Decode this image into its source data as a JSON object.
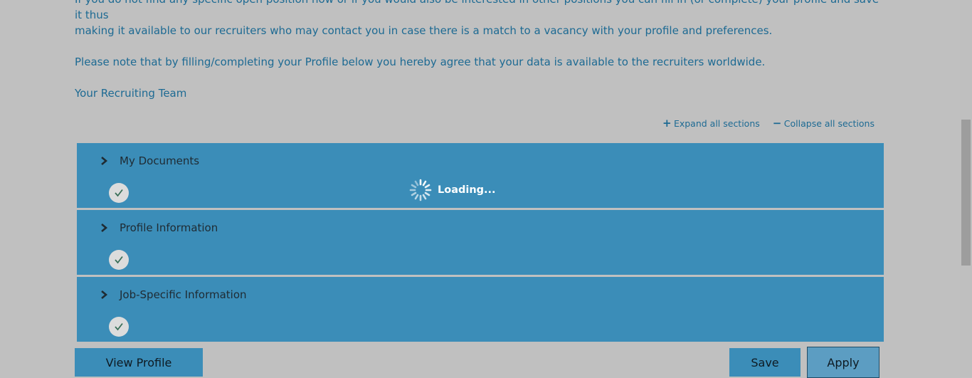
{
  "intro": {
    "line1": "If you do not find any specific open position now or if you would also be interested in other positions you can fill in (or complete) your profile and save it thus",
    "line2": "making it available to our recruiters who may contact you in case there is a match to a vacancy with your profile and preferences.",
    "line3": "Please note that by filling/completing your Profile below you hereby agree that your data is available to the recruiters worldwide.",
    "signature": "Your Recruiting Team"
  },
  "controls": {
    "expand_label": "Expand all sections",
    "collapse_label": "Collapse all sections"
  },
  "sections": [
    {
      "title": "My Documents"
    },
    {
      "title": "Profile Information"
    },
    {
      "title": "Job-Specific Information"
    }
  ],
  "loading": {
    "text": "Loading..."
  },
  "buttons": {
    "view_profile": "View Profile",
    "save": "Save",
    "apply": "Apply"
  },
  "colors": {
    "text_link": "#1d6a93",
    "section_bg": "#3b8db8",
    "page_bg": "#c0c0c0"
  }
}
